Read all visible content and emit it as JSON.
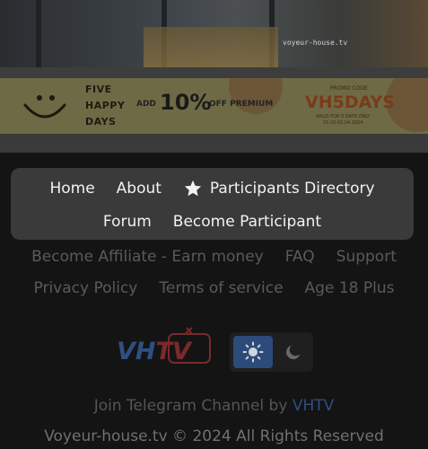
{
  "video": {
    "watermark": "voyeur-house.tv"
  },
  "banner": {
    "line1": "FIVE",
    "line2": "HAPPY",
    "line3": "DAYS",
    "add": "ADD",
    "percent": "10%",
    "off": "OFF PREMIUM",
    "promo_label": "PROMO CODE",
    "code": "VH5DAYS",
    "valid_line1": "VALID FOR 5 DAYS ONLY",
    "valid_line2": "25.03-02.04.2024"
  },
  "nav": {
    "home": "Home",
    "about": "About",
    "participants_directory": "Participants Directory",
    "forum": "Forum",
    "become_participant": "Become Participant"
  },
  "footer": {
    "become_affiliate": "Become Affiliate - Earn money",
    "faq": "FAQ",
    "support": "Support",
    "privacy": "Privacy Policy",
    "terms": "Terms of service",
    "age": "Age 18 Plus"
  },
  "logo_text": "VHTV",
  "telegram": {
    "prefix": "Join Telegram Channel by ",
    "link": "VHTV"
  },
  "copyright": "Voyeur-house.tv © 2024 All Rights Reserved",
  "colors": {
    "accent_blue": "#2c4b7a",
    "logo_blue": "#2f4f80",
    "logo_red": "#7a2a2a"
  },
  "theme_toggle": {
    "selected": "light",
    "icons": [
      "sun-icon",
      "moon-icon"
    ]
  }
}
